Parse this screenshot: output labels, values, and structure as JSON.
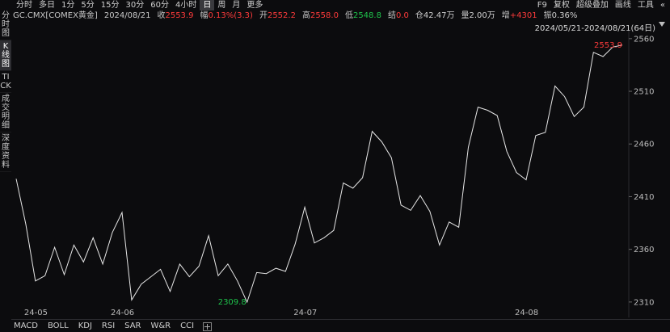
{
  "toolbar": {
    "periods": [
      {
        "label": "分时",
        "active": false
      },
      {
        "label": "多日",
        "active": false
      },
      {
        "label": "1分",
        "active": false
      },
      {
        "label": "5分",
        "active": false
      },
      {
        "label": "15分",
        "active": false
      },
      {
        "label": "30分",
        "active": false
      },
      {
        "label": "60分",
        "active": false
      },
      {
        "label": "4小时",
        "active": false
      },
      {
        "label": "日",
        "active": true
      },
      {
        "label": "周",
        "active": false
      },
      {
        "label": "月",
        "active": false
      },
      {
        "label": "更多",
        "active": false
      }
    ],
    "right": {
      "f9": "F9",
      "fuquan": "复权",
      "overlay": "超级叠加",
      "draw": "画线",
      "tools": "工具",
      "collapse": "«"
    }
  },
  "quote": {
    "symbol": "GC.CMX[COMEX黄金]",
    "date": "2024/08/21",
    "close_label": "收",
    "close": "2553.9",
    "change_label": "幅",
    "change": "0.13%(3.3)",
    "open_label": "开",
    "open": "2552.2",
    "high_label": "高",
    "high": "2558.0",
    "low_label": "低",
    "low": "2548.8",
    "settle_label": "结",
    "settle": "0.0",
    "oi_label": "仓",
    "oi": "42.47万",
    "volume_label": "量",
    "volume": "2.00万",
    "increase_label": "增",
    "increase": "+4301",
    "amplitude_label": "振",
    "amplitude": "0.36%"
  },
  "left_tabs": [
    {
      "label": "分时图",
      "active": false
    },
    {
      "label": "K线图",
      "active": true
    },
    {
      "label": "TICK",
      "active": false
    },
    {
      "label": "成交明细",
      "active": false
    },
    {
      "label": "深度资料",
      "active": false
    }
  ],
  "range_text": "2024/05/21-2024/08/21(64日)",
  "indicators": [
    "MACD",
    "BOLL",
    "KDJ",
    "RSI",
    "SAR",
    "W&R",
    "CCI"
  ],
  "colors": {
    "line": "#e6e6e6",
    "up": "#ff3b3b",
    "down": "#1ec24b",
    "axis": "#bdbdbd"
  },
  "chart_data": {
    "type": "line",
    "y_ticks": [
      2310,
      2360,
      2410,
      2460,
      2510,
      2560
    ],
    "ylim": [
      2303,
      2566
    ],
    "x_tick_labels": [
      {
        "label": "24-05",
        "index": 1
      },
      {
        "label": "24-06",
        "index": 10
      },
      {
        "label": "24-07",
        "index": 29
      },
      {
        "label": "24-08",
        "index": 52
      }
    ],
    "min_label": {
      "text": "2309.8",
      "index": 24,
      "value": 2309.8
    },
    "max_label": {
      "text": "2553.9",
      "index": 63,
      "value": 2553.9
    },
    "values": [
      2427,
      2384,
      2330,
      2335,
      2362,
      2336,
      2364,
      2348,
      2371,
      2346,
      2376,
      2395,
      2312,
      2327,
      2334,
      2341,
      2320,
      2346,
      2334,
      2344,
      2373,
      2335,
      2346,
      2330,
      2309.8,
      2338,
      2337,
      2342,
      2339,
      2365,
      2400,
      2366,
      2371,
      2378,
      2423,
      2418,
      2428,
      2472,
      2462,
      2447,
      2402,
      2397,
      2411,
      2396,
      2364,
      2386,
      2381,
      2457,
      2495,
      2492,
      2487,
      2453,
      2433,
      2426,
      2468,
      2471,
      2515,
      2505,
      2486,
      2495,
      2547,
      2543,
      2552,
      2553.9
    ]
  }
}
